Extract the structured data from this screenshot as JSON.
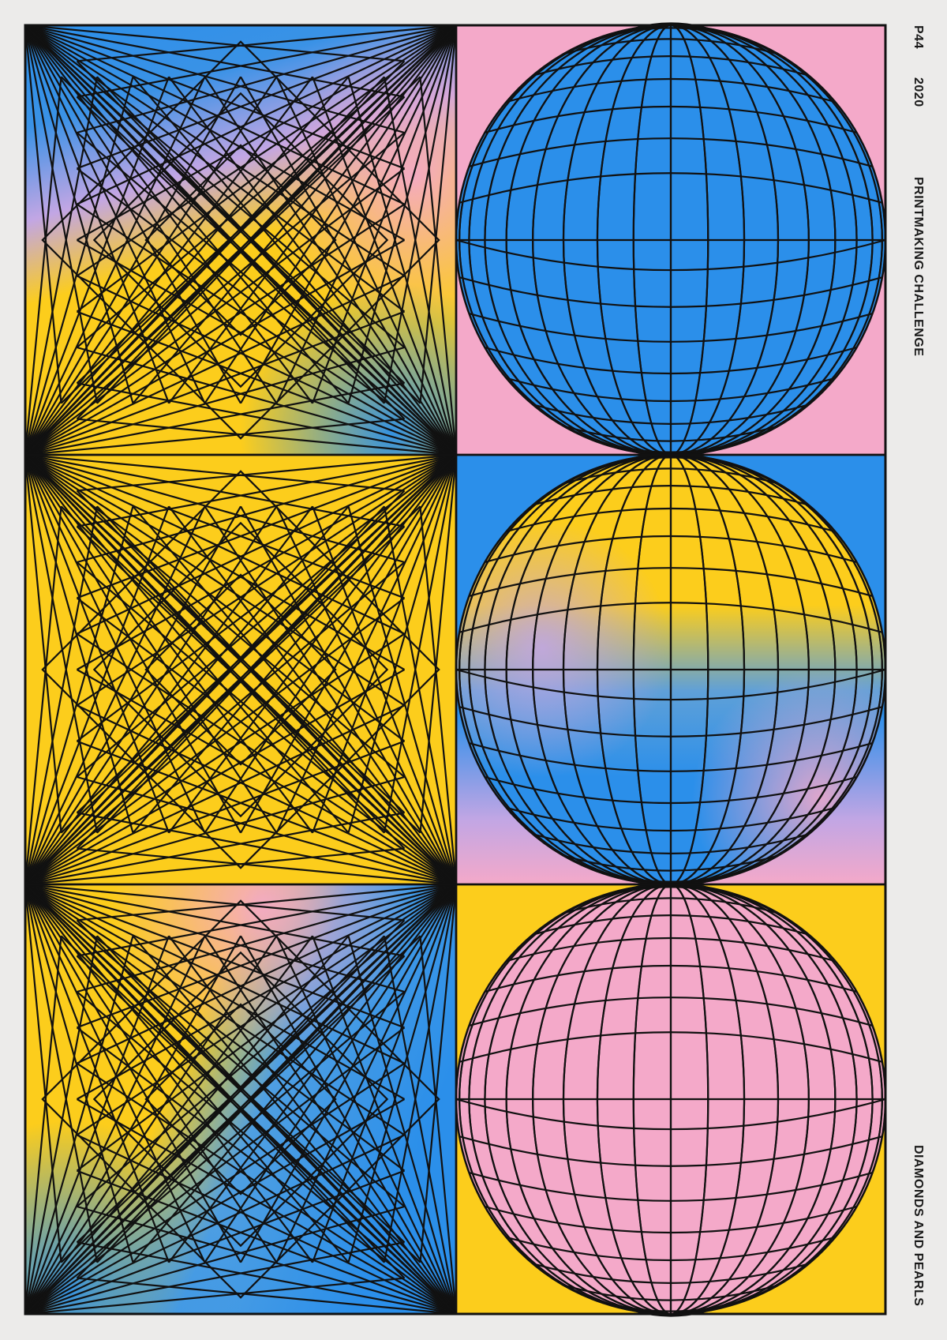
{
  "poster": {
    "code": "P44",
    "year": "2020",
    "title": "PRINTMAKING CHALLENGE",
    "subtitle": "DIAMONDS AND PEARLS"
  },
  "colors": {
    "paper": "#ecebea",
    "blue": "#2b8fea",
    "pink": "#f4a9c9",
    "yellow": "#fccd1c",
    "lavender": "#c2a6e4",
    "line": "#111111"
  },
  "panels": {
    "diamonds": [
      {
        "name": "diamond-top",
        "fill": "gradient-blue-yellow"
      },
      {
        "name": "diamond-middle",
        "fill": "yellow"
      },
      {
        "name": "diamond-bottom",
        "fill": "gradient-yellow-blue"
      }
    ],
    "pearls": [
      {
        "name": "pearl-top",
        "background": "pink",
        "sphere": "blue"
      },
      {
        "name": "pearl-middle",
        "background": "blue",
        "sphere": "gradient-yellow-blue"
      },
      {
        "name": "pearl-bottom",
        "background": "yellow",
        "sphere": "pink"
      }
    ]
  }
}
